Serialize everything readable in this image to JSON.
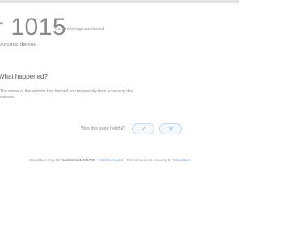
{
  "error": {
    "code": "r 1015",
    "description_line1": "You are being rate limited",
    "description_line2": "Access denied"
  },
  "section": {
    "title": "What happened?",
    "body": "The owner of this website has banned you temporarily from accessing this website."
  },
  "feedback": {
    "question": "Was this page helpful?",
    "yes_label": "✓",
    "no_label": "✕"
  },
  "footer": {
    "ray_prefix": "Cloudflare Ray ID:",
    "ray_id": "8a1b2c3d4e5f6789",
    "sep1": " • ",
    "ip_label": "Click to reveal",
    "sep2": " • ",
    "perf_label": "Performance & security by",
    "provider": "Cloudflare"
  }
}
